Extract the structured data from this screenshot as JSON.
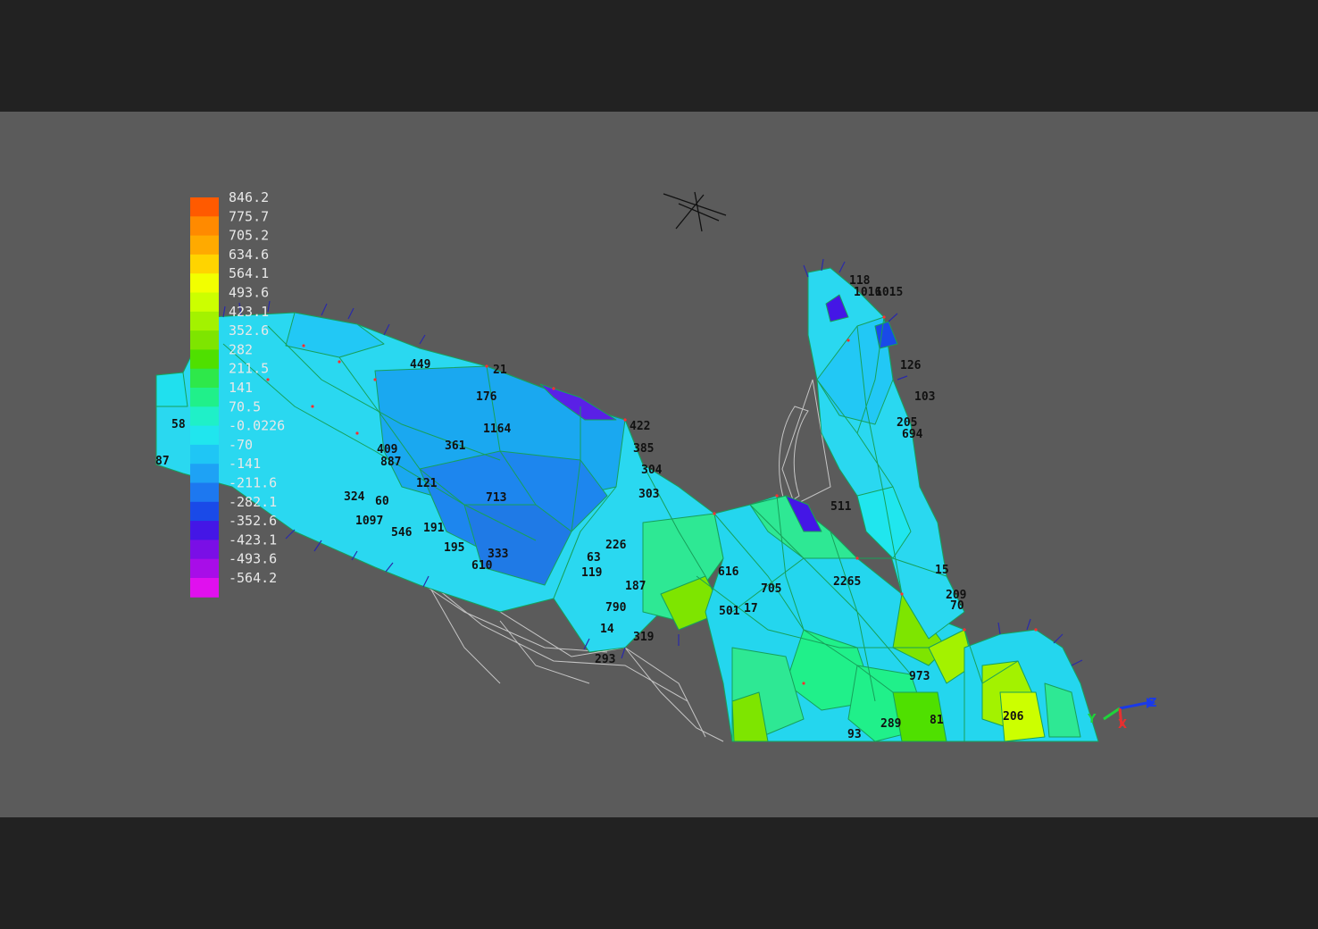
{
  "legend": {
    "values": [
      "846.2",
      "775.7",
      "705.2",
      "634.6",
      "564.1",
      "493.6",
      "423.1",
      "352.6",
      "282",
      "211.5",
      "141",
      "70.5",
      "-0.0226",
      "-70",
      "-141",
      "-211.6",
      "-282.1",
      "-352.6",
      "-423.1",
      "-493.6",
      "-564.2"
    ],
    "colors": [
      "#ff5a00",
      "#ff8a00",
      "#ffaa00",
      "#ffd400",
      "#f2ff00",
      "#ccff00",
      "#a3f200",
      "#7ee500",
      "#4fe000",
      "#2ee84a",
      "#20f08a",
      "#1ff0c8",
      "#20e6ee",
      "#1fc6f5",
      "#1ea2f5",
      "#1d78f0",
      "#1a4ae8",
      "#4416e6",
      "#7a0fe6",
      "#a80de8",
      "#e010ee"
    ]
  },
  "node_labels": [
    "58",
    "87",
    "121",
    "713",
    "176",
    "1164",
    "449",
    "21",
    "422",
    "385",
    "304",
    "303",
    "361",
    "887",
    "409",
    "546",
    "333",
    "616",
    "705",
    "119",
    "790",
    "14",
    "319",
    "293",
    "501",
    "17",
    "103",
    "205",
    "694",
    "209",
    "70",
    "973",
    "81",
    "206",
    "289",
    "93",
    "126",
    "118",
    "1016",
    "511",
    "1015",
    "610",
    "1097",
    "324",
    "60",
    "195",
    "191",
    "63",
    "187",
    "226",
    "2265",
    "15"
  ],
  "axes": {
    "x": "X",
    "y": "Y",
    "z": "Z"
  },
  "colors": {
    "viewport_bg": "#5b5b5b",
    "frame_bg": "#222222",
    "mesh_edge": "#17a05a",
    "wire": "#d8d8d8"
  }
}
